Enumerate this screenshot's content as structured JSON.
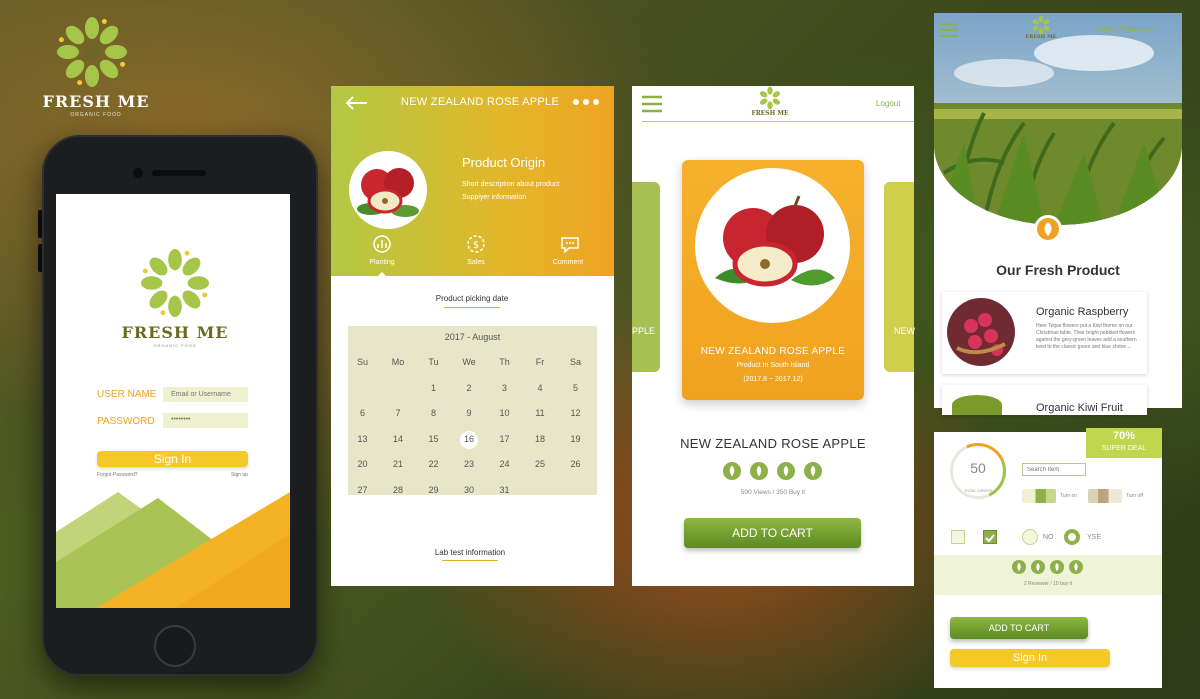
{
  "brand": {
    "name": "FRESH ME",
    "tagline": "ORGANIC FOOD"
  },
  "colors": {
    "green": "#8eb04a",
    "yellow": "#f5c82a",
    "orange": "#f0a322",
    "olive": "#6b6a1f"
  },
  "login": {
    "brand": "FRESH ME",
    "tagline": "ORGANIC FOOD",
    "username_label": "USER NAME",
    "username_placeholder": "Email or Username",
    "password_label": "PASSWORD",
    "password_value": "••••••••",
    "signin_label": "Sign In",
    "forgot_label": "Forgot Password?",
    "signup_label": "Sign up"
  },
  "detail": {
    "title": "NEW ZEALAND ROSE APPLE",
    "back_icon": "arrow-left-icon",
    "more_icon": "more-dots-icon",
    "origin_title": "Product Origin",
    "origin_line1": "Short description about product",
    "origin_line2": "Suppiyer information",
    "tabs": [
      {
        "label": "Planting",
        "icon": "plant-chart-icon"
      },
      {
        "label": "Sales",
        "icon": "coin-gear-icon"
      },
      {
        "label": "Comment",
        "icon": "chat-icon"
      }
    ],
    "picking_label": "Product picking date",
    "calendar": {
      "month": "2017 - August",
      "weekdays": [
        "Su",
        "Mo",
        "Tu",
        "We",
        "Th",
        "Fr",
        "Sa"
      ],
      "rows": [
        [
          "",
          "",
          "1",
          "2",
          "3",
          "4",
          "5"
        ],
        [
          "6",
          "7",
          "8",
          "9",
          "10",
          "11",
          "12"
        ],
        [
          "13",
          "14",
          "15",
          "16",
          "17",
          "18",
          "19"
        ],
        [
          "20",
          "21",
          "22",
          "23",
          "24",
          "25",
          "26"
        ],
        [
          "27",
          "28",
          "29",
          "30",
          "31",
          "",
          ""
        ]
      ],
      "selected": "16"
    },
    "lab_label": "Lab test information"
  },
  "product": {
    "logout_label": "Logout",
    "brand": "FRESH ME",
    "card_title": "NEW ZEALAND ROSE APPLE",
    "card_origin": "Product In South Island",
    "card_dates": "(2017.8  ~  2017.12)",
    "side_left_text": "PPLE",
    "side_right_text": "NEW",
    "name": "NEW ZEALAND ROSE APPLE",
    "leaf_count": 4,
    "stats": "500 Views  /  350 Buy it",
    "add_to_cart": "ADD TO CART"
  },
  "listing": {
    "login_label": "Login / Registered",
    "brand": "FRESH ME",
    "heading": "Our Fresh Product",
    "items": [
      {
        "name": "Organic Raspberry",
        "description": "Here Tetjue flowers put a Kiwi theme on our Christmas table. Their bright pebbled flowers against the grey-green leaves add a southern twist to the classic green and blue shrine ..."
      },
      {
        "name": "Organic Kiwi Fruit"
      }
    ]
  },
  "widgets": {
    "deal_percent": "70%",
    "deal_label": "SUPER DEAL",
    "ring_value": "50",
    "ring_label": "TOTAL ORDER",
    "search_placeholder": "Search Item",
    "turn_on": "Turn on",
    "turn_off": "Turn off",
    "radio_no": "NO",
    "radio_yes": "YSE",
    "review_stats": "2 Reviewer / 10 buy it",
    "add_to_cart": "ADD TO CART",
    "signin": "Sign In"
  }
}
